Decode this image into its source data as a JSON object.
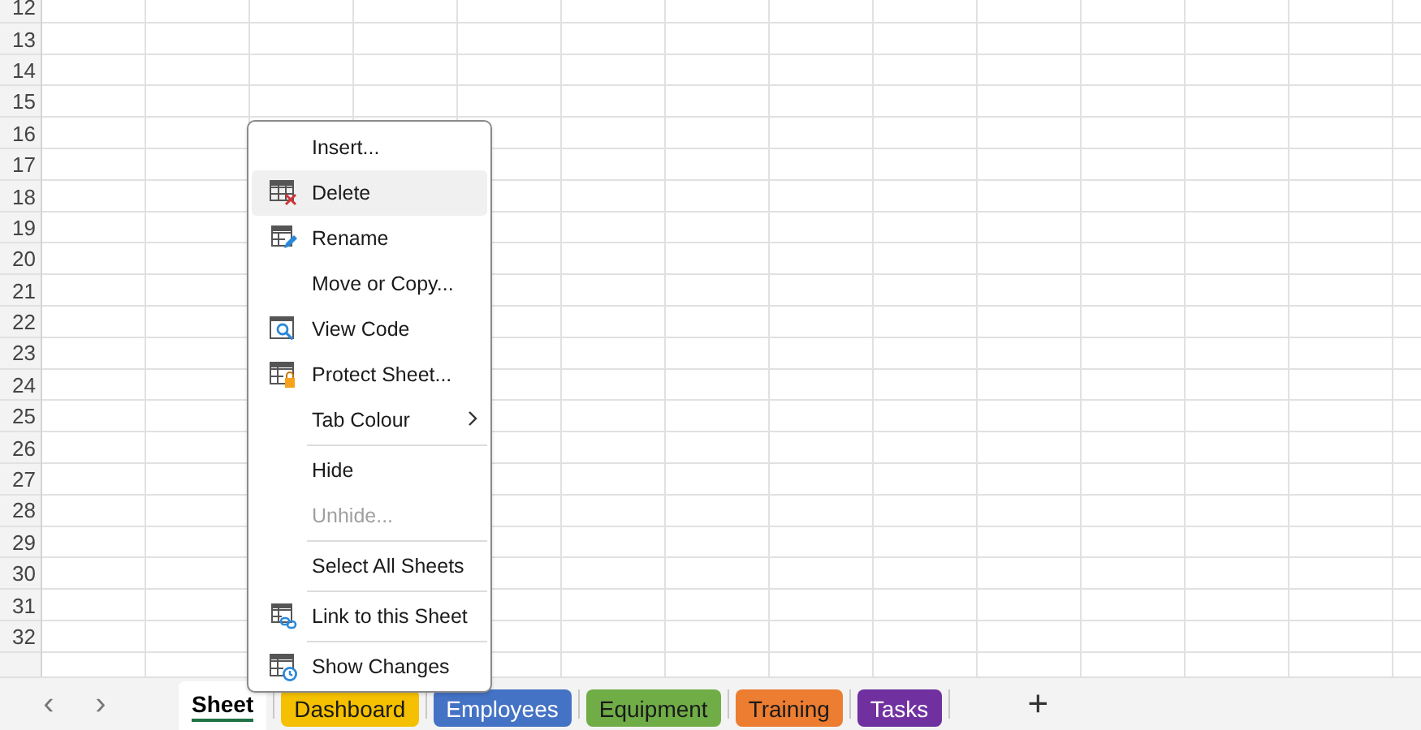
{
  "grid": {
    "row_numbers": [
      "12",
      "13",
      "14",
      "15",
      "16",
      "17",
      "18",
      "19",
      "20",
      "21",
      "22",
      "23",
      "24",
      "25",
      "26",
      "27",
      "28",
      "29",
      "30",
      "31",
      "32"
    ]
  },
  "context_menu": {
    "items": [
      {
        "kind": "item",
        "label": "Insert...",
        "selected": false,
        "disabled": false,
        "submenu": false
      },
      {
        "kind": "item",
        "label": "Delete",
        "selected": true,
        "disabled": false,
        "submenu": false
      },
      {
        "kind": "item",
        "label": "Rename",
        "selected": false,
        "disabled": false,
        "submenu": false
      },
      {
        "kind": "item",
        "label": "Move or Copy...",
        "selected": false,
        "disabled": false,
        "submenu": false
      },
      {
        "kind": "item",
        "label": "View Code",
        "selected": false,
        "disabled": false,
        "submenu": false
      },
      {
        "kind": "item",
        "label": "Protect Sheet...",
        "selected": false,
        "disabled": false,
        "submenu": false
      },
      {
        "kind": "item",
        "label": "Tab Colour",
        "selected": false,
        "disabled": false,
        "submenu": true
      },
      {
        "kind": "separator"
      },
      {
        "kind": "item",
        "label": "Hide",
        "selected": false,
        "disabled": false,
        "submenu": false
      },
      {
        "kind": "item",
        "label": "Unhide...",
        "selected": false,
        "disabled": true,
        "submenu": false
      },
      {
        "kind": "separator"
      },
      {
        "kind": "item",
        "label": "Select All Sheets",
        "selected": false,
        "disabled": false,
        "submenu": false
      },
      {
        "kind": "separator"
      },
      {
        "kind": "item",
        "label": "Link to this Sheet",
        "selected": false,
        "disabled": false,
        "submenu": false
      },
      {
        "kind": "separator"
      },
      {
        "kind": "item",
        "label": "Show Changes",
        "selected": false,
        "disabled": false,
        "submenu": false
      }
    ]
  },
  "sheet_tabs": {
    "nav": [
      "‹",
      "›"
    ],
    "tabs": [
      {
        "label": "Sheet",
        "selected": true
      },
      {
        "label": "Dashboard",
        "selected": false,
        "color": "#f5c000"
      },
      {
        "label": "Employees",
        "selected": false,
        "color": "#4472c4"
      },
      {
        "label": "Equipment",
        "selected": false,
        "color": "#70ad47"
      },
      {
        "label": "Training",
        "selected": false,
        "color": "#ed7d31"
      },
      {
        "label": "Tasks",
        "selected": false,
        "color": "#7030a0"
      }
    ],
    "add": "+"
  }
}
